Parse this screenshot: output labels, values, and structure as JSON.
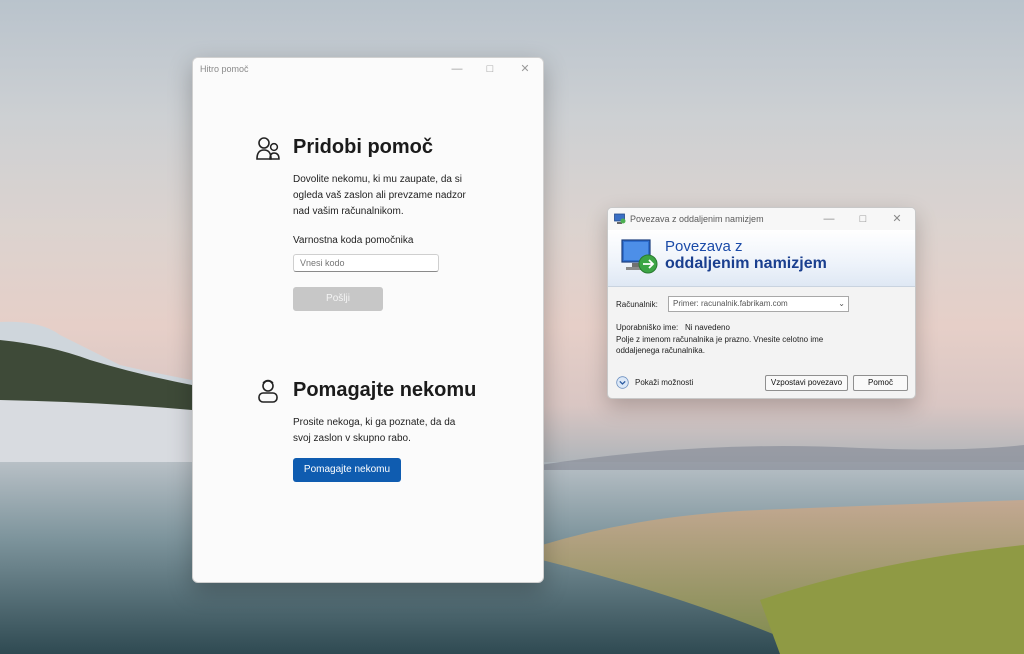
{
  "quick_assist": {
    "title": "Hitro pomoč",
    "get_help": {
      "heading": "Pridobi pomoč",
      "description_1": "Dovolite nekomu, ki mu zaupate, da si",
      "description_2": "ogleda vaš zaslon ali prevzame nadzor",
      "description_3": "nad vašim računalnikom.",
      "code_label": "Varnostna koda pomočnika",
      "code_placeholder": "Vnesi kodo",
      "submit_label": "Pošlji"
    },
    "give_help": {
      "heading": "Pomagajte nekomu",
      "description_1": "Prosite nekoga, ki ga poznate, da da",
      "description_2": "svoj zaslon v skupno rabo.",
      "button_label": "Pomagajte nekomu"
    },
    "accent_color": "#0f5cb0"
  },
  "rdp": {
    "title": "Povezava z oddaljenim namizjem",
    "banner_line1": "Povezava z",
    "banner_line2": "oddaljenim namizjem",
    "computer_label": "Računalnik:",
    "computer_value": "Primer: racunalnik.fabrikam.com",
    "username_label": "Uporabniško ime:",
    "username_value": "Ni navedeno",
    "message_line1": "Polje z imenom računalnika je prazno. Vnesite celotno ime",
    "message_line2": "oddaljenega računalnika.",
    "show_options_label": "Pokaži možnosti",
    "connect_label": "Vzpostavi povezavo",
    "help_label": "Pomoč"
  },
  "icons": {
    "minimize": "minimize-icon",
    "maximize": "maximize-icon",
    "close": "close-icon",
    "people": "people-icon",
    "person_support": "person-support-icon",
    "rdp_app": "remote-desktop-icon",
    "expand": "chevron-down-circle-icon"
  }
}
